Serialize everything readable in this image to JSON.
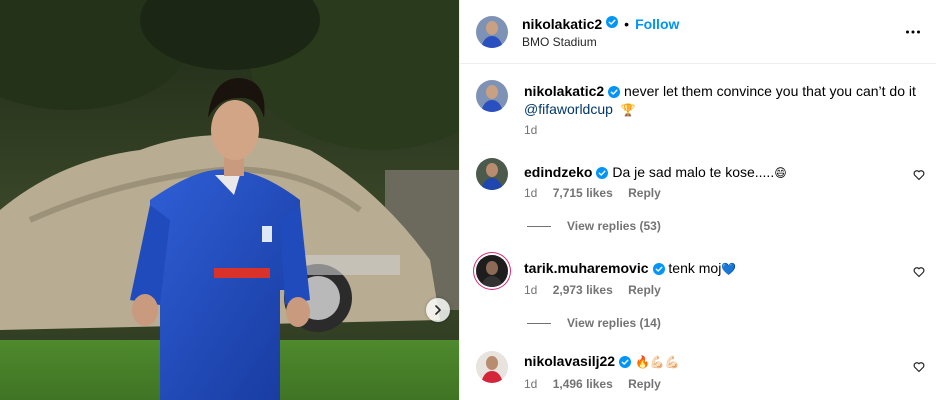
{
  "header": {
    "username": "nikolakatic2",
    "separator": "•",
    "follow_label": "Follow",
    "location": "BMO Stadium"
  },
  "caption": {
    "username": "nikolakatic2",
    "text": "never let them convince you that you can’t do it",
    "mention": "@fifaworldcup",
    "emoji": "🏆",
    "time": "1d"
  },
  "comments": [
    {
      "username": "edindzeko",
      "text": "Da je sad malo te kose.....",
      "emoji": "😄",
      "time": "1d",
      "likes": "7,715 likes",
      "reply_label": "Reply",
      "view_replies": "View replies (53)"
    },
    {
      "username": "tarik.muharemovic",
      "text": "tenk moj",
      "emoji": "💙",
      "time": "1d",
      "likes": "2,973 likes",
      "reply_label": "Reply",
      "view_replies": "View replies (14)"
    },
    {
      "username": "nikolavasilj22",
      "text": "",
      "emoji": "🔥💪🏻💪🏻",
      "time": "1d",
      "likes": "1,496 likes",
      "reply_label": "Reply"
    }
  ],
  "colors": {
    "accent": "#0095f6",
    "verified": "#0095f6",
    "mention": "#00376b",
    "muted": "#737373",
    "divider": "#efefef"
  },
  "icons": {
    "carousel_next": "chevron-right-icon",
    "more": "more-horizontal-icon",
    "like": "heart-outline-icon",
    "verified": "verified-badge-icon"
  }
}
